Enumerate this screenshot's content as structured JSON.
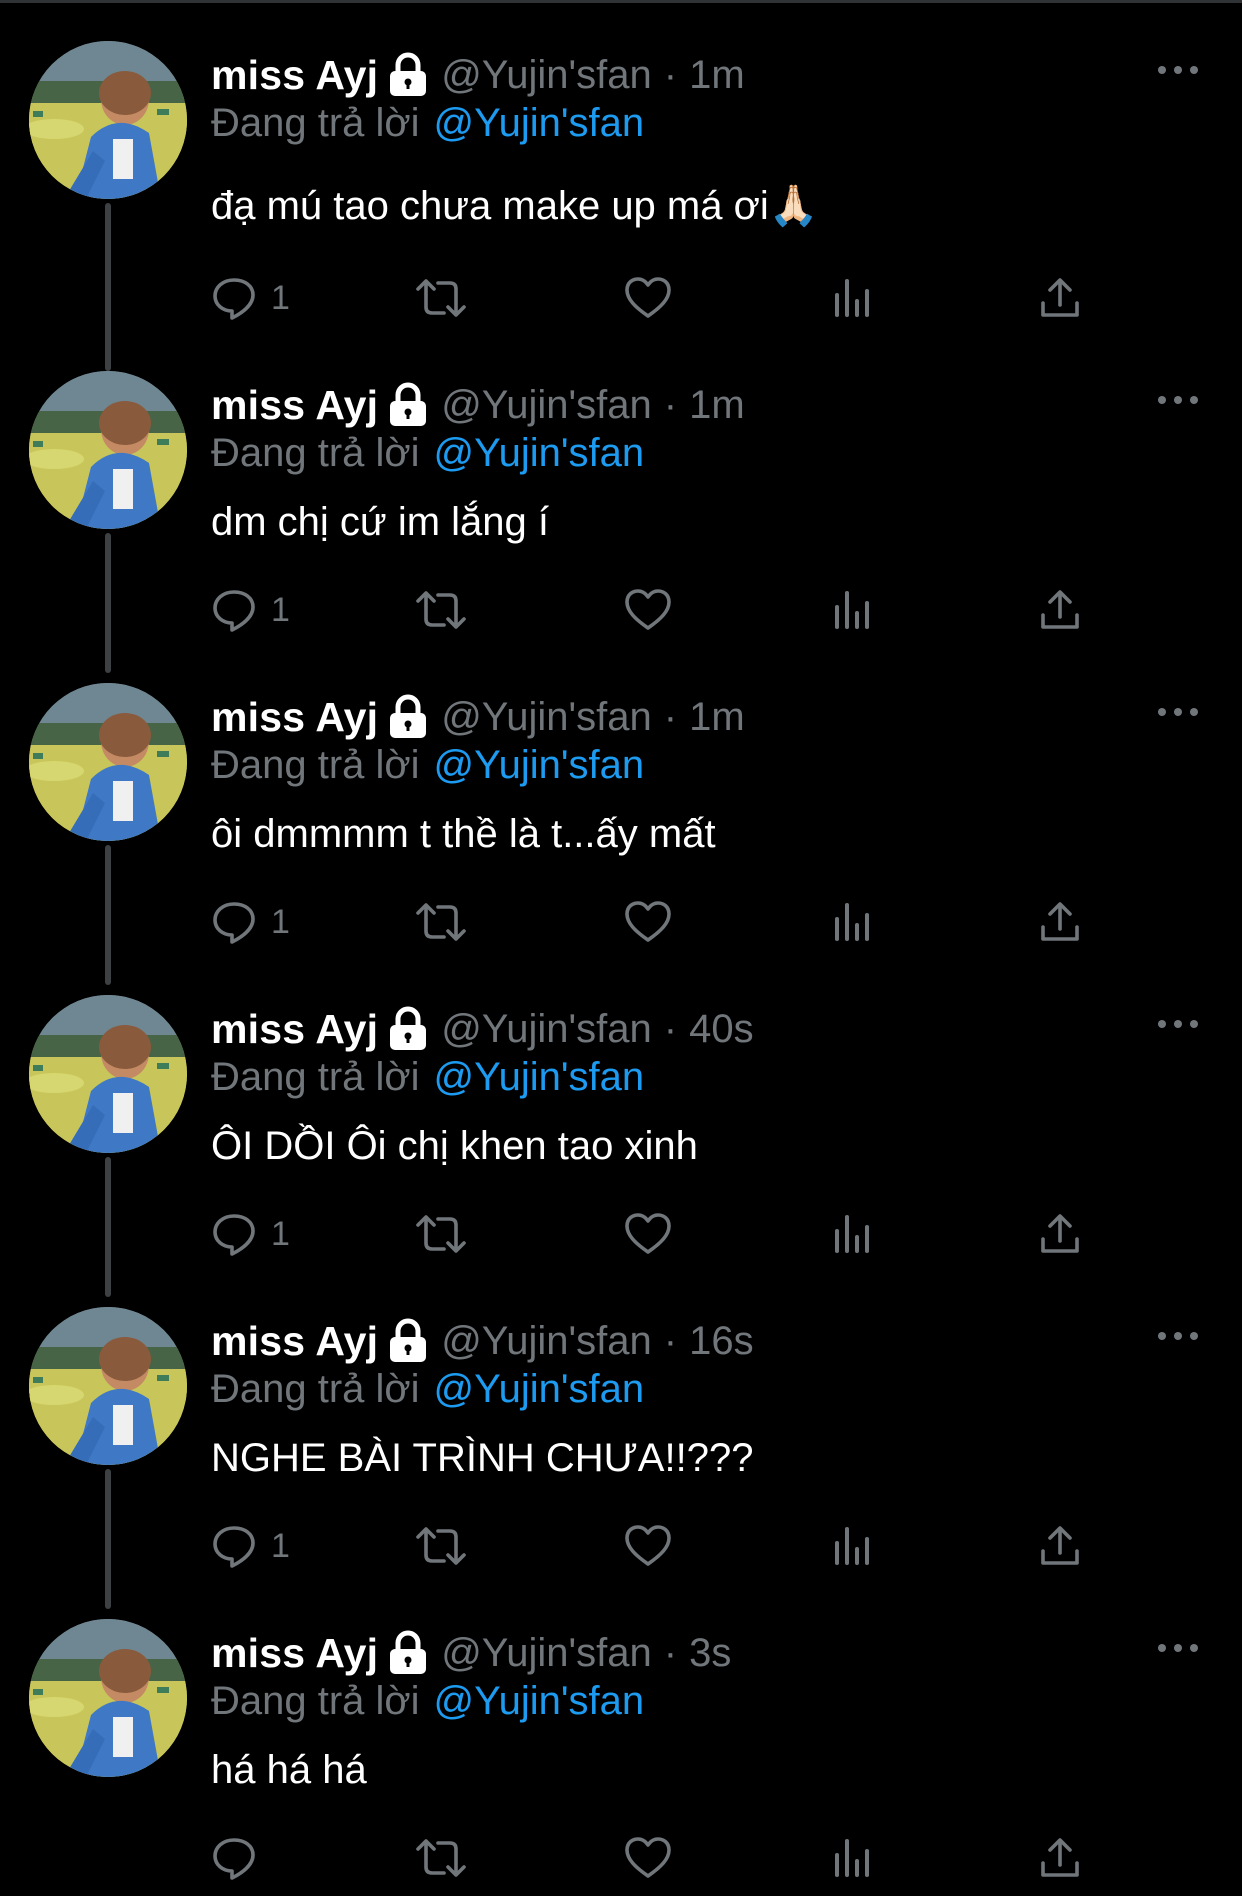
{
  "colors": {
    "background": "#000000",
    "name": "#ffffff",
    "secondary": "#71767b",
    "mention": "#1d9bf0",
    "thread_line": "#3e4144"
  },
  "icons": {
    "lock": "lock-icon",
    "more": "more-horizontal-icon",
    "reply": "reply-bubble-icon",
    "retweet": "retweet-icon",
    "like": "heart-icon",
    "views": "views-bars-icon",
    "share": "share-upload-icon"
  },
  "tweets": [
    {
      "name": "miss Ayj",
      "handle": "@Yujin'sfan",
      "separator": "·",
      "time": "1m",
      "reply_prefix": "Đang trả lời",
      "reply_to": "@Yujin'sfan",
      "text": "đạ mú tao chưa make up má ơi🙏🏻",
      "reply_count": "1"
    },
    {
      "name": "miss Ayj",
      "handle": "@Yujin'sfan",
      "separator": "·",
      "time": "1m",
      "reply_prefix": "Đang trả lời",
      "reply_to": "@Yujin'sfan",
      "text": "dm chị cứ im lắng í",
      "reply_count": "1"
    },
    {
      "name": "miss Ayj",
      "handle": "@Yujin'sfan",
      "separator": "·",
      "time": "1m",
      "reply_prefix": "Đang trả lời",
      "reply_to": "@Yujin'sfan",
      "text": "ôi dmmmm t thề là t...ấy mất",
      "reply_count": "1"
    },
    {
      "name": "miss Ayj",
      "handle": "@Yujin'sfan",
      "separator": "·",
      "time": "40s",
      "reply_prefix": "Đang trả lời",
      "reply_to": "@Yujin'sfan",
      "text": "ÔI DỒI Ôi chị khen tao xinh",
      "reply_count": "1"
    },
    {
      "name": "miss Ayj",
      "handle": "@Yujin'sfan",
      "separator": "·",
      "time": "16s",
      "reply_prefix": "Đang trả lời",
      "reply_to": "@Yujin'sfan",
      "text": "NGHE BÀI TRÌNH CHƯA!!???",
      "reply_count": "1"
    },
    {
      "name": "miss Ayj",
      "handle": "@Yujin'sfan",
      "separator": "·",
      "time": "3s",
      "reply_prefix": "Đang trả lời",
      "reply_to": "@Yujin'sfan",
      "text": "há há há",
      "reply_count": ""
    }
  ]
}
